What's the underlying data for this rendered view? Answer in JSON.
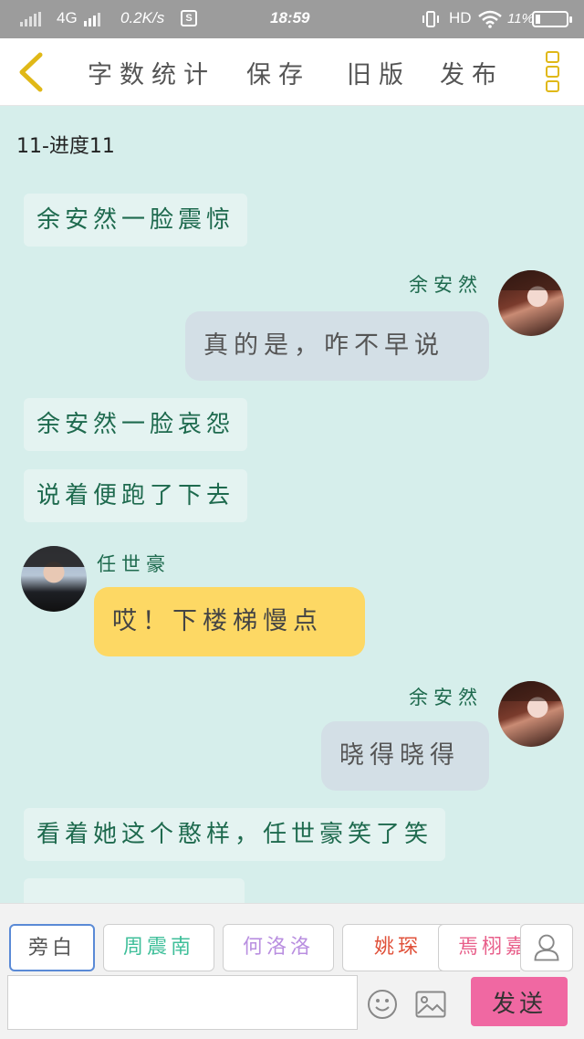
{
  "status_bar": {
    "network": "4G",
    "speed": "0.2K/s",
    "s_badge": "S",
    "time": "18:59",
    "hd": "HD",
    "battery": "11%"
  },
  "top_bar": {
    "menu": [
      "字数统计",
      "保存",
      "旧版",
      "发布"
    ]
  },
  "chat": {
    "progress_label": "11-进度11",
    "messages": [
      {
        "type": "narration",
        "text": "余安然一脸震惊"
      },
      {
        "type": "right",
        "name": "余安然",
        "text": "真的是，咋不早说"
      },
      {
        "type": "narration",
        "text": "余安然一脸哀怨"
      },
      {
        "type": "narration",
        "text": "说着便跑了下去"
      },
      {
        "type": "left",
        "name": "任世豪",
        "text": "哎！下楼梯慢点"
      },
      {
        "type": "right",
        "name": "余安然",
        "text": "晓得晓得"
      },
      {
        "type": "narration",
        "text": "看着她这个憨样，任世豪笑了笑"
      }
    ]
  },
  "bottom": {
    "roles": [
      {
        "label": "旁白",
        "color": "#555555"
      },
      {
        "label": "周震南",
        "color": "#3fbf9a"
      },
      {
        "label": "何洛洛",
        "color": "#b98fe0"
      },
      {
        "label": "姚琛",
        "color": "#e0513a"
      },
      {
        "label": "焉栩嘉",
        "color": "#e85f8a"
      }
    ],
    "input_placeholder": "",
    "send_label": "发送"
  }
}
